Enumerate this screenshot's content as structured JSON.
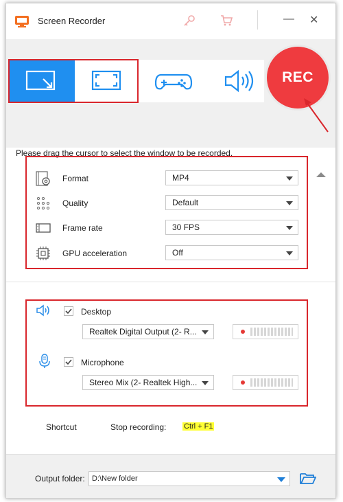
{
  "window": {
    "title": "Screen Recorder"
  },
  "titlebar": {
    "icons": [
      "key-icon",
      "cart-icon"
    ],
    "minimize": "—",
    "close": "✕"
  },
  "modes": [
    {
      "name": "region-capture",
      "active": true
    },
    {
      "name": "fullscreen-capture",
      "active": false
    },
    {
      "name": "game-capture",
      "active": false
    },
    {
      "name": "audio-only",
      "active": false
    }
  ],
  "rec_button": {
    "label": "REC",
    "color": "#ef3b3f"
  },
  "hint": "Please drag the cursor to select the window to be recorded.",
  "settings": {
    "format": {
      "label": "Format",
      "value": "MP4"
    },
    "quality": {
      "label": "Quality",
      "value": "Default"
    },
    "frame_rate": {
      "label": "Frame rate",
      "value": "30 FPS"
    },
    "gpu": {
      "label": "GPU acceleration",
      "value": "Off"
    }
  },
  "audio": {
    "desktop": {
      "label": "Desktop",
      "checked": true,
      "device": "Realtek Digital Output (2- R..."
    },
    "microphone": {
      "label": "Microphone",
      "checked": true,
      "device": "Stereo Mix (2- Realtek High..."
    }
  },
  "shortcut": {
    "label": "Shortcut",
    "stop_label": "Stop recording:",
    "keys": "Ctrl + F1"
  },
  "output": {
    "label": "Output folder:",
    "path": "D:\\New folder"
  },
  "colors": {
    "accent": "#1f8ff0",
    "rec": "#ef3b3f",
    "highlight_box": "#d9262c",
    "panel_bg": "#f0f0f0"
  }
}
